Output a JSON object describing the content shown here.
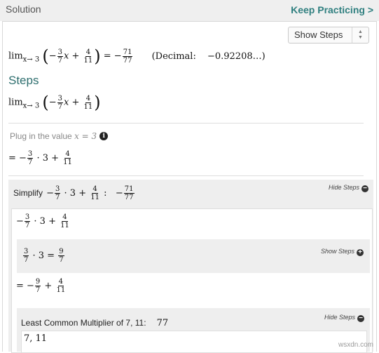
{
  "header": {
    "title": "Solution",
    "keep_practicing": "Keep Practicing >"
  },
  "select": {
    "selected": "Show Steps"
  },
  "result": {
    "lim_prefix": "lim",
    "lim_sub": "x→ 3",
    "frac1": {
      "num": "3",
      "den": "7"
    },
    "frac2": {
      "num": "4",
      "den": "11"
    },
    "equals": "= −",
    "answer": {
      "num": "71",
      "den": "77"
    },
    "decimal_label": "(Decimal:",
    "decimal_value": "−0.92208…)"
  },
  "steps_heading": "Steps",
  "plug": {
    "text": "Plug in the value",
    "var": "x = 3"
  },
  "plugged": {
    "f1": {
      "num": "3",
      "den": "7"
    },
    "mid": "· 3 +",
    "f2": {
      "num": "4",
      "den": "11"
    }
  },
  "simplify": {
    "label": "Simplify",
    "toggle": "Hide Steps",
    "result": {
      "num": "71",
      "den": "77"
    }
  },
  "step_a": {
    "f1": {
      "num": "3",
      "den": "7"
    },
    "mid": "· 3 +",
    "f2": {
      "num": "4",
      "den": "11"
    }
  },
  "sub1": {
    "toggle": "Show Steps",
    "f1": {
      "num": "3",
      "den": "7"
    },
    "mid": "· 3 =",
    "f2": {
      "num": "9",
      "den": "7"
    }
  },
  "step_b": {
    "f1": {
      "num": "9",
      "den": "7"
    },
    "f2": {
      "num": "4",
      "den": "11"
    }
  },
  "lcm": {
    "label": "Least Common Multiplier of 7, 11:",
    "value": "77",
    "toggle": "Hide Steps",
    "line": "7, 11"
  },
  "watermark": "wsxdn.com"
}
